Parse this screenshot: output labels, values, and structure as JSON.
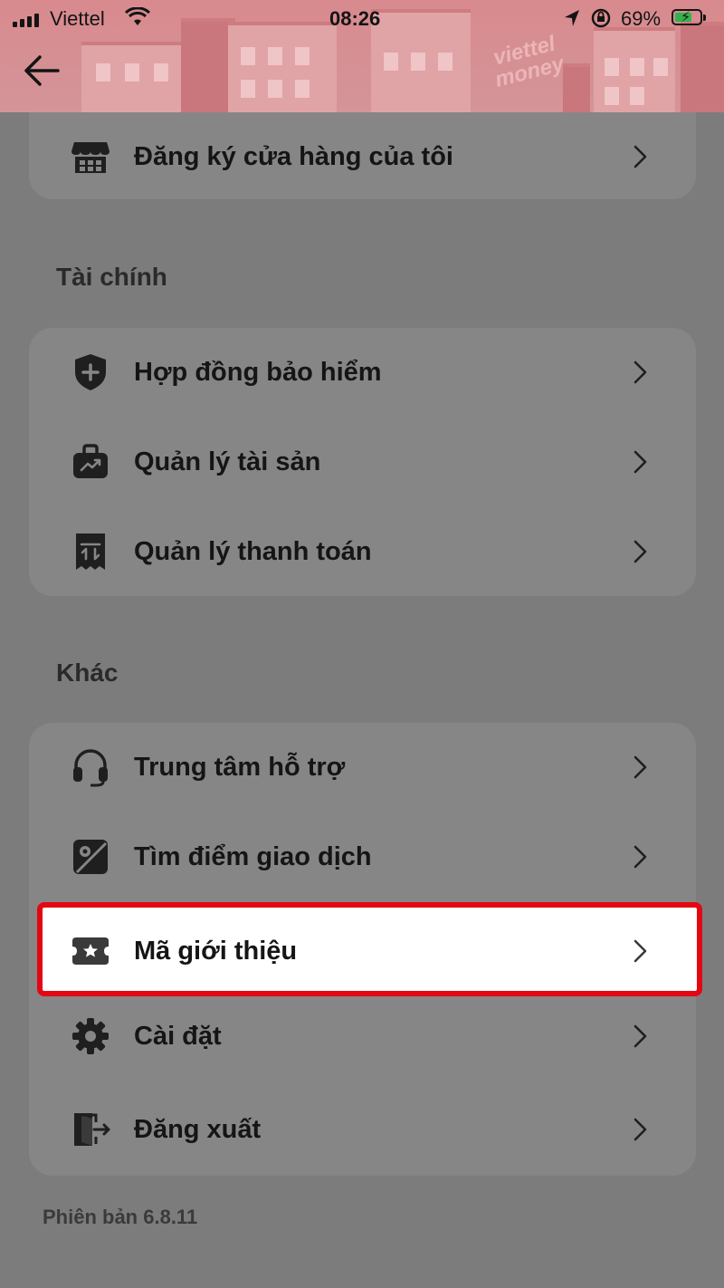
{
  "status_bar": {
    "carrier": "Viettel",
    "time": "08:26",
    "battery": "69%"
  },
  "header": {
    "brand_line1": "viettel",
    "brand_line2": "money",
    "back_icon": "arrow-left-icon"
  },
  "store": {
    "label": "Đăng ký cửa hàng của tôi",
    "icon": "store-icon"
  },
  "finance": {
    "title": "Tài chính",
    "items": [
      {
        "label": "Hợp đồng bảo hiểm",
        "icon": "shield-plus-icon"
      },
      {
        "label": "Quản lý tài sản",
        "icon": "briefcase-chart-icon"
      },
      {
        "label": "Quản lý thanh toán",
        "icon": "receipt-icon"
      }
    ]
  },
  "other": {
    "title": "Khác",
    "items": [
      {
        "label": "Trung tâm hỗ trợ",
        "icon": "headset-icon"
      },
      {
        "label": "Tìm điểm giao dịch",
        "icon": "map-pin-icon"
      },
      {
        "label": "Mã giới thiệu",
        "icon": "ticket-star-icon",
        "highlighted": true
      },
      {
        "label": "Cài đặt",
        "icon": "gear-icon"
      },
      {
        "label": "Đăng xuất",
        "icon": "logout-icon"
      }
    ]
  },
  "footer": {
    "version": "Phiên bản 6.8.11"
  },
  "colors": {
    "highlight_border": "#e30613",
    "overlay": "#7c7c7c",
    "header": "#d98a8e"
  }
}
